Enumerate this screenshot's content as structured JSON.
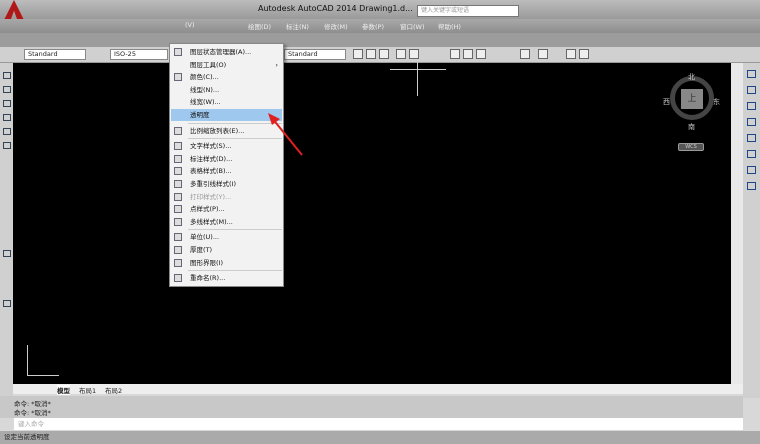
{
  "window": {
    "title": "Autodesk AutoCAD 2014    Drawing1.d...",
    "search_placeholder": "键入关键字或短语"
  },
  "menubar": [
    "(V)",
    "绘图(D)",
    "标注(N)",
    "修改(M)",
    "参数(P)",
    "窗口(W)",
    "帮助(H)"
  ],
  "toolbar": {
    "text_style": "Standard",
    "dim_style": "ISO-25",
    "table_style": "Standard"
  },
  "format_menu": {
    "items": [
      {
        "label": "图层状态管理器(A)...",
        "icon": "layer-state-icon"
      },
      {
        "label": "图层工具(O)",
        "submenu": true
      },
      {
        "label": "颜色(C)...",
        "icon": "color-icon"
      },
      {
        "label": "线型(N)..."
      },
      {
        "label": "线宽(W)..."
      },
      {
        "label": "透明度",
        "highlighted": true
      },
      {
        "label": "比例缩放列表(E)...",
        "icon": "scale-list-icon"
      },
      {
        "label": "文字样式(S)...",
        "icon": "text-style-icon"
      },
      {
        "label": "标注样式(D)...",
        "icon": "dim-style-icon"
      },
      {
        "label": "表格样式(B)...",
        "icon": "table-style-icon"
      },
      {
        "label": "多重引线样式(I)",
        "icon": "mleader-style-icon"
      },
      {
        "label": "打印样式(Y)...",
        "icon": "plot-style-icon",
        "disabled": true
      },
      {
        "label": "点样式(P)...",
        "icon": "point-style-icon"
      },
      {
        "label": "多线样式(M)...",
        "icon": "mline-style-icon"
      },
      {
        "label": "单位(U)...",
        "icon": "units-icon"
      },
      {
        "label": "厚度(T)",
        "icon": "thickness-icon"
      },
      {
        "label": "图形界限(I)",
        "icon": "limits-icon"
      },
      {
        "label": "重命名(R)...",
        "icon": "rename-icon"
      }
    ]
  },
  "viewcube": {
    "north": "北",
    "south": "南",
    "east": "东",
    "west": "西",
    "face": "上",
    "wcs": "WCS"
  },
  "tabs": [
    "模型",
    "布局1",
    "布局2"
  ],
  "command": {
    "history": [
      "命令: *取消*",
      "命令: *取消*"
    ],
    "placeholder": "键入命令"
  },
  "status": "设定当前透明度"
}
